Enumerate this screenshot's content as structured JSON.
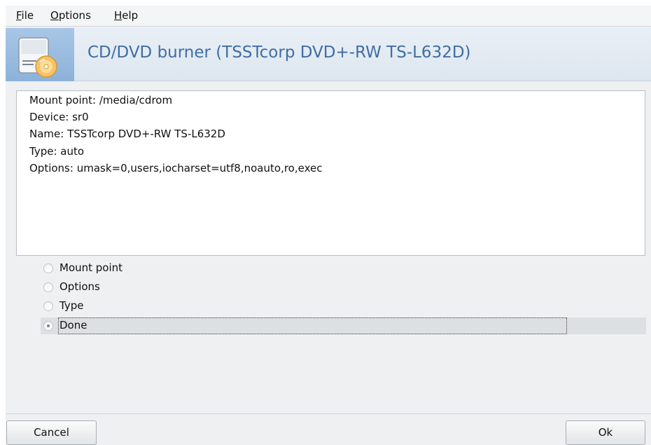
{
  "menubar": {
    "items": [
      {
        "accel": "F",
        "rest": "ile"
      },
      {
        "accel": "O",
        "rest": "ptions"
      },
      {
        "accel": "H",
        "rest": "elp"
      }
    ]
  },
  "banner": {
    "icon": "cd-drive-icon",
    "title": "CD/DVD burner (TSSTcorp DVD+-RW TS-L632D)"
  },
  "info": {
    "lines": [
      "Mount point: /media/cdrom",
      "Device: sr0",
      "Name: TSSTcorp DVD+-RW TS-L632D",
      "Type: auto",
      "Options: umask=0,users,iocharset=utf8,noauto,ro,exec"
    ]
  },
  "radios": {
    "items": [
      {
        "label": "Mount point",
        "selected": false
      },
      {
        "label": "Options",
        "selected": false
      },
      {
        "label": "Type",
        "selected": false
      },
      {
        "label": "Done",
        "selected": true
      }
    ]
  },
  "buttons": {
    "cancel": "Cancel",
    "ok": "Ok"
  },
  "colors": {
    "banner_title": "#3f6ea3",
    "banner_icon_bg": "#9bbde0",
    "selected_row": "#dde0e3"
  }
}
